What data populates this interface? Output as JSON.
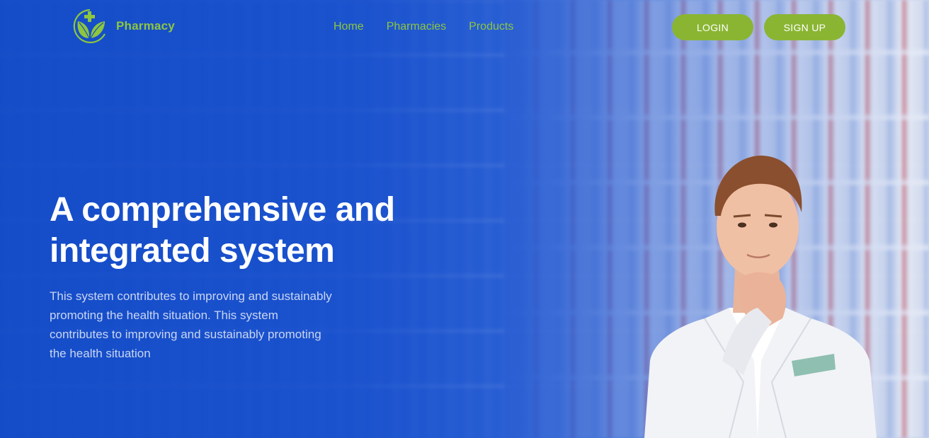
{
  "brand": {
    "name": "Pharmacy",
    "accent_color": "#8dc63f",
    "logo_icon": "leaf-cross-icon"
  },
  "nav": {
    "items": [
      {
        "label": "Home"
      },
      {
        "label": "Pharmacies"
      },
      {
        "label": "Products"
      }
    ]
  },
  "auth": {
    "login_label": "LOGIN",
    "signup_label": "SIGN UP",
    "button_color": "#8ab533"
  },
  "hero": {
    "headline": "A comprehensive and integrated system",
    "description": "This system contributes to improving and sustainably promoting the health situation. This system contributes to improving and sustainably promoting the health situation",
    "background_color": "#1b4fc4",
    "image": "pharmacist-photo"
  }
}
